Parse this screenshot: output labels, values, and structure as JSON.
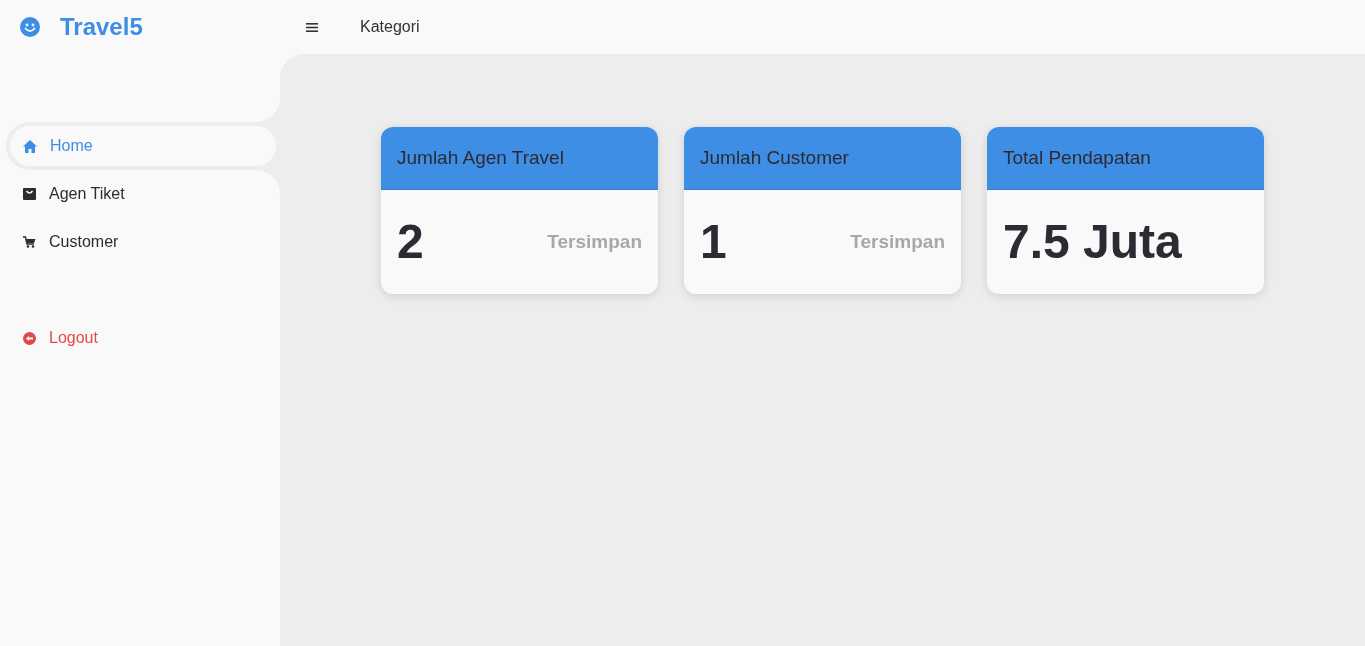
{
  "brand": {
    "name": "Travel5"
  },
  "topbar": {
    "nav": [
      {
        "label": "Kategori"
      }
    ]
  },
  "sidebar": {
    "items": [
      {
        "label": "Home",
        "kind": "home",
        "selected": true
      },
      {
        "label": "Agen Tiket",
        "kind": "bag",
        "selected": false
      },
      {
        "label": "Customer",
        "kind": "cart",
        "selected": false
      }
    ],
    "logout": {
      "label": "Logout"
    }
  },
  "cards": [
    {
      "title": "Jumlah Agen Travel",
      "value": "2",
      "note": "Tersimpan"
    },
    {
      "title": "Jumlah Customer",
      "value": "1",
      "note": "Tersimpan"
    },
    {
      "title": "Total Pendapatan",
      "value": "7.5 Juta"
    }
  ]
}
